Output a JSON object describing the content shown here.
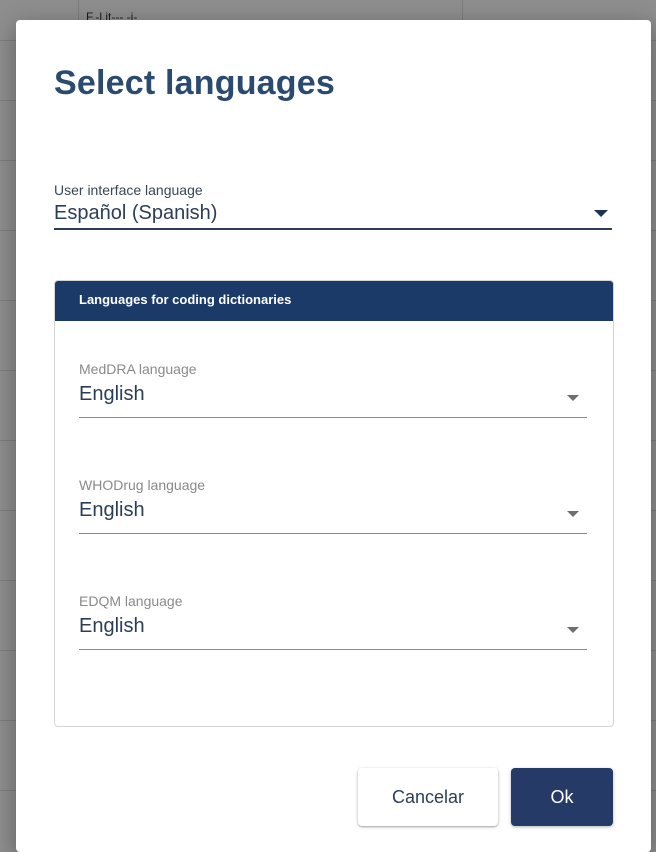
{
  "background": {
    "partial_text": "F.-l.it--- -i-"
  },
  "dialog": {
    "title": "Select languages",
    "ui_language": {
      "label": "User interface language",
      "value": "Español (Spanish)"
    },
    "coding_panel": {
      "header": "Languages for coding dictionaries",
      "meddra": {
        "label": "MedDRA language",
        "value": "English"
      },
      "whodrug": {
        "label": "WHODrug language",
        "value": "English"
      },
      "edqm": {
        "label": "EDQM language",
        "value": "English"
      }
    },
    "buttons": {
      "cancel": "Cancelar",
      "ok": "Ok"
    }
  },
  "colors": {
    "title": "#2b4a6f",
    "panel_header": "#1c3a68",
    "ok_button": "#253a66"
  }
}
